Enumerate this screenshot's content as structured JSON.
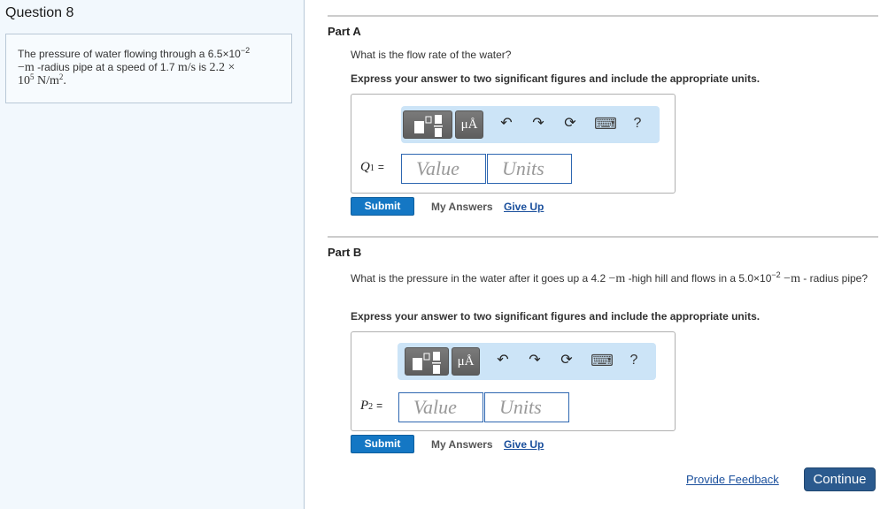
{
  "question": {
    "title": "Question 8",
    "text_prefix": "The pressure of water flowing through a 6.5×10",
    "radius_exp": "−2",
    "unit_m": "−m",
    "text_mid": " -radius pipe at a speed of 1.7 ",
    "speed_unit": "m/s",
    "text_is": " is ",
    "pressure_val": "2.2 ×",
    "pressure_base": "10",
    "pressure_exp": "5",
    "pressure_unit": " N/m",
    "pressure_unit_exp": "2",
    "period": "."
  },
  "parts": [
    {
      "title": "Part A",
      "prompt": "What is the flow rate of the water?",
      "instruction": "Express your answer to two significant figures and include the appropriate units.",
      "variable": "Q",
      "variable_sub": "1",
      "equals": "=",
      "value_placeholder": "Value",
      "units_placeholder": "Units",
      "submit_label": "Submit",
      "my_answers_label": "My Answers",
      "give_up_label": "Give Up"
    },
    {
      "title": "Part B",
      "prompt_a": "What is the pressure in the water after it goes up a 4.2 ",
      "prompt_unit1": "−m",
      "prompt_b": " -high hill and flows in a 5.0×10",
      "prompt_exp": "−2",
      "prompt_unit2": " −m",
      "prompt_c": " - radius pipe?",
      "instruction": "Express your answer to two significant figures and include the appropriate units.",
      "variable": "P",
      "variable_sub": "2",
      "equals": "=",
      "value_placeholder": "Value",
      "units_placeholder": "Units",
      "submit_label": "Submit",
      "my_answers_label": "My Answers",
      "give_up_label": "Give Up"
    }
  ],
  "toolbar": {
    "template_icon": "fraction-template-icon",
    "units_label": "μÅ",
    "undo_icon": "↶",
    "redo_icon": "↷",
    "reset_icon": "⟳",
    "keyboard_icon": "⌨",
    "help_label": "?"
  },
  "footer": {
    "feedback_label": "Provide Feedback",
    "continue_label": "Continue"
  }
}
